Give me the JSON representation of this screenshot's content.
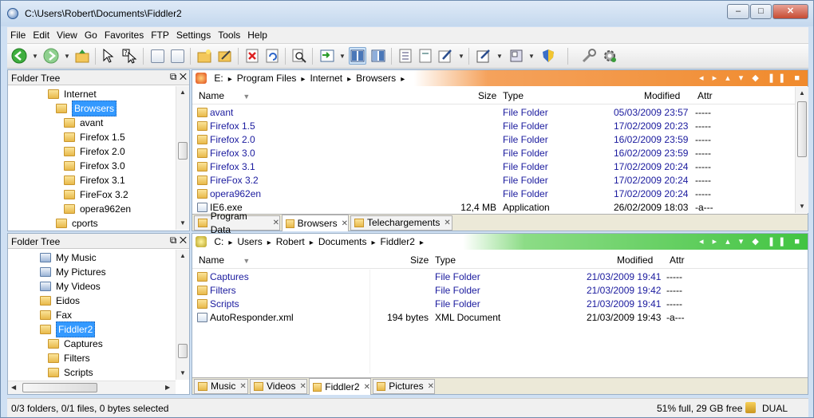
{
  "window": {
    "title": "C:\\Users\\Robert\\Documents\\Fiddler2",
    "minimize": "–",
    "maximize": "□",
    "close": "✕"
  },
  "menu": [
    "File",
    "Edit",
    "View",
    "Go",
    "Favorites",
    "FTP",
    "Settings",
    "Tools",
    "Help"
  ],
  "toolbar_icons": [
    "back-icon",
    "forward-icon",
    "up-folder-icon",
    "select-icon",
    "help-select-icon",
    "copy-icon",
    "paste-icon",
    "new-folder-icon",
    "rename-icon",
    "delete-icon",
    "undo-icon",
    "find-icon",
    "view-mode-icon",
    "dual-pane-icon",
    "columns-icon",
    "details-view-icon",
    "checklist-icon",
    "document-icon",
    "edit-icon",
    "properties-icon",
    "layout-icon",
    "shield-icon",
    "tools-icon",
    "settings-gear-icon"
  ],
  "tree_top": {
    "title": "Folder Tree",
    "items": [
      {
        "label": "Internet",
        "level": 0
      },
      {
        "label": "Browsers",
        "level": 1,
        "selected": true
      },
      {
        "label": "avant",
        "level": 2
      },
      {
        "label": "Firefox 1.5",
        "level": 2
      },
      {
        "label": "Firefox 2.0",
        "level": 2
      },
      {
        "label": "Firefox 3.0",
        "level": 2
      },
      {
        "label": "Firefox 3.1",
        "level": 2
      },
      {
        "label": "FireFox 3.2",
        "level": 2
      },
      {
        "label": "opera962en",
        "level": 2
      },
      {
        "label": "cports",
        "level": 1
      }
    ]
  },
  "tree_bottom": {
    "title": "Folder Tree",
    "items": [
      {
        "label": "My Music",
        "level": 0,
        "special": true
      },
      {
        "label": "My Pictures",
        "level": 0,
        "special": true
      },
      {
        "label": "My Videos",
        "level": 0,
        "special": true
      },
      {
        "label": "Eidos",
        "level": 0
      },
      {
        "label": "Fax",
        "level": 0
      },
      {
        "label": "Fiddler2",
        "level": 0,
        "selected": true
      },
      {
        "label": "Captures",
        "level": 1
      },
      {
        "label": "Filters",
        "level": 1
      },
      {
        "label": "Scripts",
        "level": 1
      }
    ]
  },
  "pane_top": {
    "path": [
      "E:",
      "▸",
      "Program Files",
      "▸",
      "Internet",
      "▸",
      "Browsers",
      "▸"
    ],
    "controls": "◂ ▸ ▴ ▾ ◆ ❚❚ ■",
    "columns": {
      "name": "Name",
      "size": "Size",
      "type": "Type",
      "modified": "Modified",
      "attr": "Attr"
    },
    "rows": [
      {
        "name": "avant",
        "size": "",
        "type": "File Folder",
        "modified": "05/03/2009 23:57",
        "attr": "-----"
      },
      {
        "name": "Firefox 1.5",
        "size": "",
        "type": "File Folder",
        "modified": "17/02/2009 20:23",
        "attr": "-----"
      },
      {
        "name": "Firefox 2.0",
        "size": "",
        "type": "File Folder",
        "modified": "16/02/2009 23:59",
        "attr": "-----"
      },
      {
        "name": "Firefox 3.0",
        "size": "",
        "type": "File Folder",
        "modified": "16/02/2009 23:59",
        "attr": "-----"
      },
      {
        "name": "Firefox 3.1",
        "size": "",
        "type": "File Folder",
        "modified": "17/02/2009 20:24",
        "attr": "-----"
      },
      {
        "name": "FireFox 3.2",
        "size": "",
        "type": "File Folder",
        "modified": "17/02/2009 20:24",
        "attr": "-----"
      },
      {
        "name": "opera962en",
        "size": "",
        "type": "File Folder",
        "modified": "17/02/2009 20:24",
        "attr": "-----"
      },
      {
        "name": "IE6.exe",
        "size": "12,4 MB",
        "type": "Application",
        "modified": "26/02/2009 18:03",
        "attr": "-a---"
      }
    ],
    "tabs": [
      "Program Data",
      "Browsers",
      "Telechargements"
    ]
  },
  "pane_bottom": {
    "path": [
      "C:",
      "▸",
      "Users",
      "▸",
      "Robert",
      "▸",
      "Documents",
      "▸",
      "Fiddler2",
      "▸"
    ],
    "controls": "◂ ▸ ▴ ▾ ◆ ❚❚ ■",
    "columns": {
      "name": "Name",
      "size": "Size",
      "type": "Type",
      "modified": "Modified",
      "attr": "Attr"
    },
    "rows": [
      {
        "name": "Captures",
        "size": "",
        "type": "File Folder",
        "modified": "21/03/2009 19:41",
        "attr": "-----"
      },
      {
        "name": "Filters",
        "size": "",
        "type": "File Folder",
        "modified": "21/03/2009 19:42",
        "attr": "-----"
      },
      {
        "name": "Scripts",
        "size": "",
        "type": "File Folder",
        "modified": "21/03/2009 19:41",
        "attr": "-----"
      },
      {
        "name": "AutoResponder.xml",
        "size": "194 bytes",
        "type": "XML Document",
        "modified": "21/03/2009 19:43",
        "attr": "-a---"
      }
    ],
    "tabs": [
      "Music",
      "Videos",
      "Fiddler2",
      "Pictures"
    ]
  },
  "status": {
    "left": "0/3 folders, 0/1 files, 0 bytes selected",
    "disk": "51% full, 29 GB free",
    "mode": "DUAL"
  },
  "colors": {
    "top_accent": "#f08a2c",
    "bottom_accent": "#42c442",
    "selection": "#3399ff",
    "link_text": "#1a1a9e"
  }
}
